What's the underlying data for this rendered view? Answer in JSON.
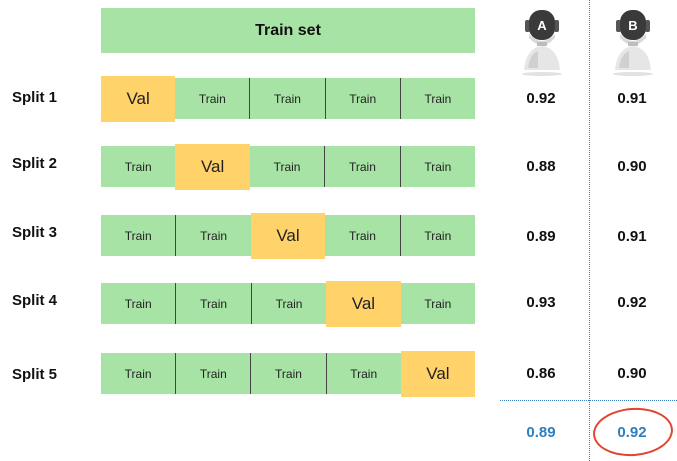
{
  "train_set_label": "Train set",
  "robot_a_letter": "A",
  "robot_b_letter": "B",
  "splits": [
    {
      "label": "Split 1",
      "folds": [
        "Val",
        "Train",
        "Train",
        "Train",
        "Train"
      ],
      "score_a": "0.92",
      "score_b": "0.91"
    },
    {
      "label": "Split 2",
      "folds": [
        "Train",
        "Val",
        "Train",
        "Train",
        "Train"
      ],
      "score_a": "0.88",
      "score_b": "0.90"
    },
    {
      "label": "Split 3",
      "folds": [
        "Train",
        "Train",
        "Val",
        "Train",
        "Train"
      ],
      "score_a": "0.89",
      "score_b": "0.91"
    },
    {
      "label": "Split 4",
      "folds": [
        "Train",
        "Train",
        "Train",
        "Val",
        "Train"
      ],
      "score_a": "0.93",
      "score_b": "0.92"
    },
    {
      "label": "Split 5",
      "folds": [
        "Train",
        "Train",
        "Train",
        "Train",
        "Val"
      ],
      "score_a": "0.86",
      "score_b": "0.90"
    }
  ],
  "average_a": "0.89",
  "average_b": "0.92",
  "colors": {
    "train": "#a7e3a5",
    "val": "#ffd26a",
    "average_text": "#2e7fbf",
    "highlight_circle": "#e2442f"
  }
}
